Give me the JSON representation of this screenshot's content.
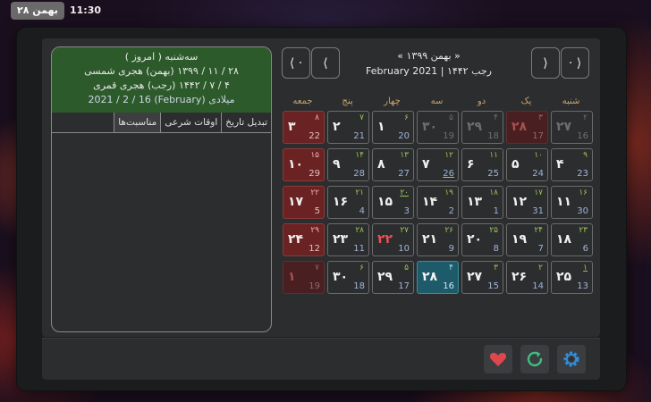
{
  "topbar": {
    "clock": "11:30",
    "date_pill": "۲۸ بهمن"
  },
  "calendar": {
    "prev_year_label": "⟨ ·",
    "prev_month_label": "⟨",
    "next_month_label": "⟩",
    "next_year_label": "· ⟩",
    "month_title": "« بهمن ۱۳۹۹ »",
    "sub_title": "رجب ۱۴۴۲ | February 2021",
    "weekdays": [
      "شنبه",
      "یک",
      "دو",
      "سه",
      "چهار",
      "پنج",
      "جمعه"
    ]
  },
  "info": {
    "line1": "سه‌شنبه    ( امروز )",
    "line2": "۲۸ / ۱۱ / ۱۳۹۹ (بهمن) هجری شمسی",
    "line3": "۴ / ۷ / ۱۴۴۲ (رجب) هجری قمری",
    "line4": "میلادی (February) 2021 / 2 / 16",
    "tabs": [
      "تبدیل تاریخ",
      "اوقات شرعی",
      "مناسبت‌ها"
    ]
  },
  "footer": {
    "favorite_icon": "heart-icon",
    "refresh_icon": "refresh-icon",
    "settings_icon": "gear-icon",
    "favorite_color": "#e0474c",
    "refresh_color": "#3fbf7f",
    "settings_color": "#2f8fe0"
  },
  "weeks": [
    [
      {
        "p": "۲۷",
        "h": "۲",
        "g": "16",
        "other": true
      },
      {
        "p": "۲۸",
        "h": "۳",
        "g": "17",
        "other": true,
        "holiday": true
      },
      {
        "p": "۲۹",
        "h": "۴",
        "g": "18",
        "other": true
      },
      {
        "p": "۳۰",
        "h": "۵",
        "g": "19",
        "other": true
      },
      {
        "p": "۱",
        "h": "۶",
        "g": "20"
      },
      {
        "p": "۲",
        "h": "۷",
        "g": "21"
      },
      {
        "p": "۳",
        "h": "۸",
        "g": "22",
        "holiday": true
      }
    ],
    [
      {
        "p": "۴",
        "h": "۹",
        "g": "23"
      },
      {
        "p": "۵",
        "h": "۱۰",
        "g": "24"
      },
      {
        "p": "۶",
        "h": "۱۱",
        "g": "25"
      },
      {
        "p": "۷",
        "h": "۱۲",
        "g": "26",
        "gu": true
      },
      {
        "p": "۸",
        "h": "۱۳",
        "g": "27"
      },
      {
        "p": "۹",
        "h": "۱۴",
        "g": "28"
      },
      {
        "p": "۱۰",
        "h": "۱۵",
        "g": "29",
        "holiday": true
      }
    ],
    [
      {
        "p": "۱۱",
        "h": "۱۶",
        "g": "30"
      },
      {
        "p": "۱۲",
        "h": "۱۷",
        "g": "31"
      },
      {
        "p": "۱۳",
        "h": "۱۸",
        "g": "1"
      },
      {
        "p": "۱۴",
        "h": "۱۹",
        "g": "2"
      },
      {
        "p": "۱۵",
        "h": "۲۰",
        "g": "3",
        "hu": true
      },
      {
        "p": "۱۶",
        "h": "۲۱",
        "g": "4"
      },
      {
        "p": "۱۷",
        "h": "۲۲",
        "g": "5",
        "holiday": true
      }
    ],
    [
      {
        "p": "۱۸",
        "h": "۲۳",
        "g": "6"
      },
      {
        "p": "۱۹",
        "h": "۲۴",
        "g": "7"
      },
      {
        "p": "۲۰",
        "h": "۲۵",
        "g": "8"
      },
      {
        "p": "۲۱",
        "h": "۲۶",
        "g": "9"
      },
      {
        "p": "۲۲",
        "h": "۲۷",
        "g": "10",
        "event": true
      },
      {
        "p": "۲۳",
        "h": "۲۸",
        "g": "11"
      },
      {
        "p": "۲۴",
        "h": "۲۹",
        "g": "12",
        "holiday": true
      }
    ],
    [
      {
        "p": "۲۵",
        "h": "۱",
        "g": "13",
        "hu": true
      },
      {
        "p": "۲۶",
        "h": "۲",
        "g": "14"
      },
      {
        "p": "۲۷",
        "h": "۳",
        "g": "15"
      },
      {
        "p": "۲۸",
        "h": "۴",
        "g": "16",
        "today": true
      },
      {
        "p": "۲۹",
        "h": "۵",
        "g": "17"
      },
      {
        "p": "۳۰",
        "h": "۶",
        "g": "18"
      },
      {
        "p": "۱",
        "h": "۷",
        "g": "19",
        "other": true,
        "holiday": true
      }
    ]
  ]
}
